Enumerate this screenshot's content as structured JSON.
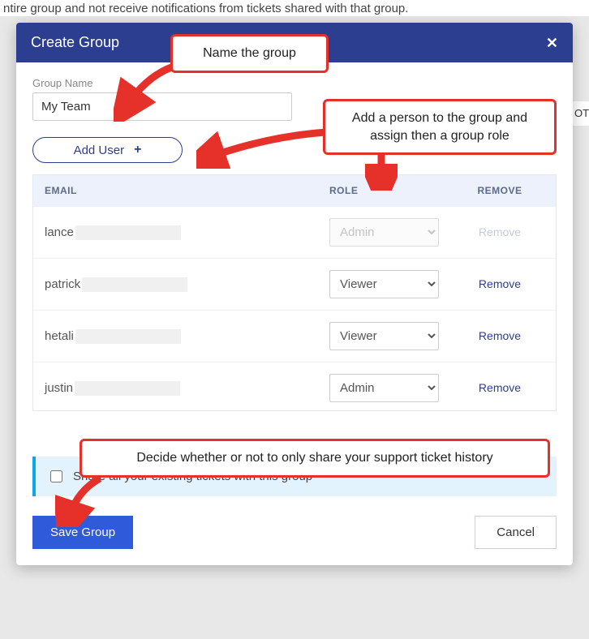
{
  "background": {
    "partial_text": "ntire group and not receive notifications from tickets shared with that group.",
    "right_fragment": "OT"
  },
  "modal": {
    "title": "Create Group",
    "group_name_label": "Group Name",
    "group_name_value": "My Team",
    "add_user_label": "Add User",
    "table": {
      "headers": {
        "email": "EMAIL",
        "role": "ROLE",
        "remove": "REMOVE"
      },
      "role_options": [
        "Admin",
        "Viewer"
      ],
      "rows": [
        {
          "email_prefix": "lance",
          "role": "Admin",
          "remove_label": "Remove",
          "remove_disabled": true,
          "role_disabled": true
        },
        {
          "email_prefix": "patrick",
          "role": "Viewer",
          "remove_label": "Remove",
          "remove_disabled": false,
          "role_disabled": false
        },
        {
          "email_prefix": "hetali",
          "role": "Viewer",
          "remove_label": "Remove",
          "remove_disabled": false,
          "role_disabled": false
        },
        {
          "email_prefix": "justin",
          "role": "Admin",
          "remove_label": "Remove",
          "remove_disabled": false,
          "role_disabled": false
        }
      ]
    },
    "share_checkbox_label": "Share all your existing tickets with this group",
    "share_checked": false,
    "save_label": "Save Group",
    "cancel_label": "Cancel"
  },
  "annotations": {
    "name_group": "Name the group",
    "add_person": "Add a person to the group and assign then a group role",
    "share_decide": "Decide whether or not to only share your support ticket history"
  }
}
